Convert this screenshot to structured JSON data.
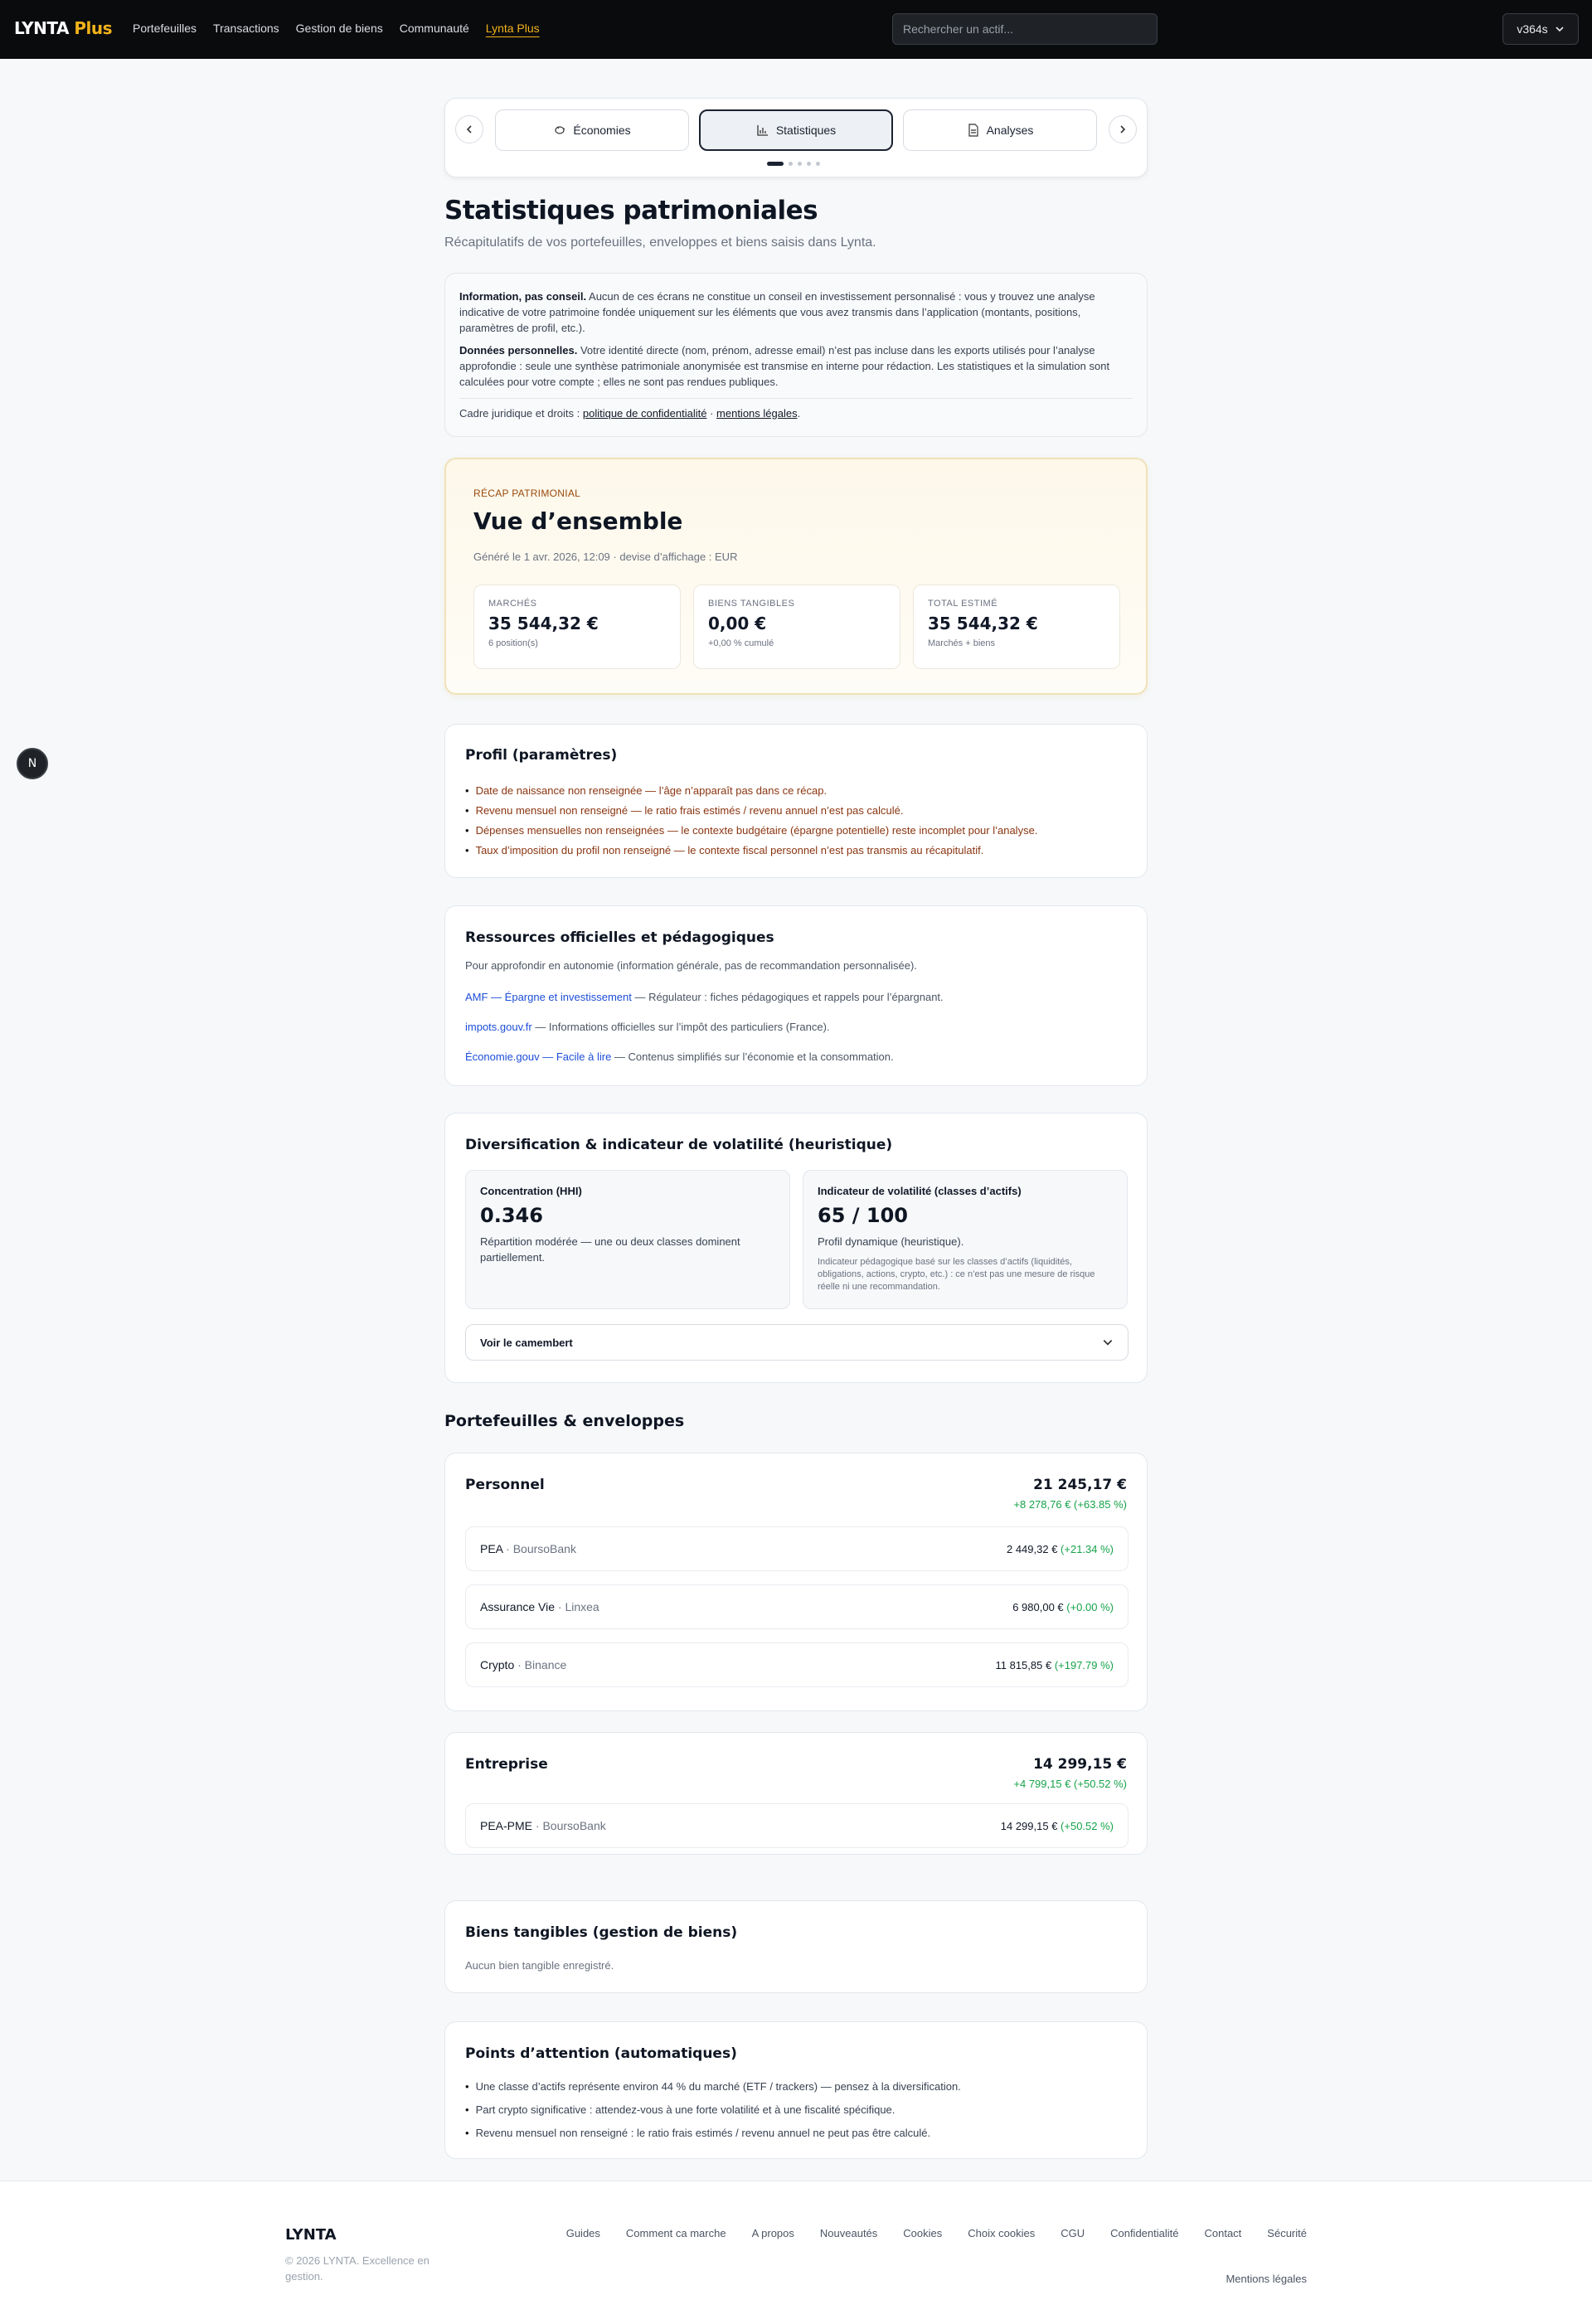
{
  "header": {
    "logo_main": "LYNTA",
    "logo_plus": "Plus",
    "nav": [
      "Portefeuilles",
      "Transactions",
      "Gestion de biens",
      "Communauté",
      "Lynta Plus"
    ],
    "search_placeholder": "Rechercher un actif...",
    "user": "v364s"
  },
  "carousel": {
    "tabs": [
      "Économies",
      "Statistiques",
      "Analyses"
    ],
    "active_tab": "Statistiques"
  },
  "page": {
    "title": "Statistiques patrimoniales",
    "subtitle": "Récapitulatifs de vos portefeuilles, enveloppes et biens saisis dans Lynta."
  },
  "info": {
    "p1_bold": "Information, pas conseil.",
    "p1_text": " Aucun de ces écrans ne constitue un conseil en investissement personnalisé : vous y trouvez une analyse indicative de votre patrimoine fondée uniquement sur les éléments que vous avez transmis dans l’application (montants, positions, paramètres de profil, etc.).",
    "p2_bold": "Données personnelles.",
    "p2_text": " Votre identité directe (nom, prénom, adresse email) n’est pas incluse dans les exports utilisés pour l’analyse approfondie : seule une synthèse patrimoniale anonymisée est transmise en interne pour rédaction. Les statistiques et la simulation sont calculées pour votre compte ; elles ne sont pas rendues publiques.",
    "legal_prefix": "Cadre juridique et droits : ",
    "privacy_link": "politique de confidentialité",
    "legal_sep": " · ",
    "legal_link": "mentions légales",
    "legal_suffix": "."
  },
  "recap": {
    "eyebrow": "RÉCAP PATRIMONIAL",
    "title": "Vue d’ensemble",
    "generated": "Généré le 1 avr. 2026, 12:09 · devise d’affichage : EUR",
    "metrics": [
      {
        "label": "MARCHÉS",
        "value": "35 544,32 €",
        "sub": "6 position(s)"
      },
      {
        "label": "BIENS TANGIBLES",
        "value": "0,00 €",
        "sub": "+0,00 % cumulé"
      },
      {
        "label": "TOTAL ESTIMÉ",
        "value": "35 544,32 €",
        "sub": "Marchés + biens"
      }
    ]
  },
  "profile": {
    "title": "Profil (paramètres)",
    "items": [
      "Date de naissance non renseignée — l’âge n’apparaît pas dans ce récap.",
      "Revenu mensuel non renseigné — le ratio frais estimés / revenu annuel n’est pas calculé.",
      "Dépenses mensuelles non renseignées — le contexte budgétaire (épargne potentielle) reste incomplet pour l’analyse.",
      "Taux d’imposition du profil non renseigné — le contexte fiscal personnel n’est pas transmis au récapitulatif."
    ]
  },
  "resources": {
    "title": "Ressources officielles et pédagogiques",
    "lead": "Pour approfondir en autonomie (information générale, pas de recommandation personnalisée).",
    "items": [
      {
        "link": "AMF — Épargne et investissement",
        "desc": " — Régulateur : fiches pédagogiques et rappels pour l’épargnant."
      },
      {
        "link": "impots.gouv.fr",
        "desc": " — Informations officielles sur l’impôt des particuliers (France)."
      },
      {
        "link": "Économie.gouv — Facile à lire",
        "desc": " — Contenus simplifiés sur l’économie et la consommation."
      }
    ]
  },
  "diversification": {
    "title": "Diversification & indicateur de volatilité (heuristique)",
    "hhi": {
      "label": "Concentration (HHI)",
      "value": "0.346",
      "desc": "Répartition modérée — une ou deux classes dominent partiellement."
    },
    "vol": {
      "label": "Indicateur de volatilité (classes d’actifs)",
      "value": "65 / 100",
      "desc": "Profil dynamique (heuristique).",
      "note": "Indicateur pédagogique basé sur les classes d’actifs (liquidités, obligations, actions, crypto, etc.) : ce n’est pas une mesure de risque réelle ni une recommandation."
    },
    "pie_toggle": "Voir le camembert"
  },
  "portfolios": {
    "section_title": "Portefeuilles & enveloppes",
    "personnel": {
      "name": "Personnel",
      "total": "21 245,17 €",
      "gain": "+8 278,76 € (+63.85 %)",
      "envelopes": [
        {
          "name": "PEA",
          "bank": " · BoursoBank",
          "value": "2 449,32 € ",
          "gain": "(+21.34 %)"
        },
        {
          "name": "Assurance Vie",
          "bank": " · Linxea",
          "value": "6 980,00 € ",
          "gain": "(+0.00 %)"
        },
        {
          "name": "Crypto",
          "bank": " · Binance",
          "value": "11 815,85 € ",
          "gain": "(+197.79 %)"
        }
      ]
    },
    "entreprise": {
      "name": "Entreprise",
      "total": "14 299,15 €",
      "gain": "+4 799,15 € (+50.52 %)",
      "envelopes": [
        {
          "name": "PEA-PME",
          "bank": " · BoursoBank",
          "value": "14 299,15 € ",
          "gain": "(+50.52 %)"
        }
      ]
    }
  },
  "tangibles": {
    "title": "Biens tangibles (gestion de biens)",
    "empty": "Aucun bien tangible enregistré."
  },
  "attention": {
    "title": "Points d’attention (automatiques)",
    "items": [
      "Une classe d’actifs représente environ 44 % du marché (ETF / trackers) — pensez à la diversification.",
      "Part crypto significative : attendez-vous à une forte volatilité et à une fiscalité spécifique.",
      "Revenu mensuel non renseigné : le ratio frais estimés / revenu annuel ne peut pas être calculé."
    ]
  },
  "footer": {
    "logo": "LYNTA",
    "copy": "© 2026 LYNTA. Excellence en gestion.",
    "links": [
      "Guides",
      "Comment ca marche",
      "A propos",
      "Nouveautés",
      "Cookies",
      "Choix cookies",
      "CGU",
      "Confidentialité",
      "Contact",
      "Sécurité"
    ],
    "legal": "Mentions légales"
  },
  "float_button": "N"
}
